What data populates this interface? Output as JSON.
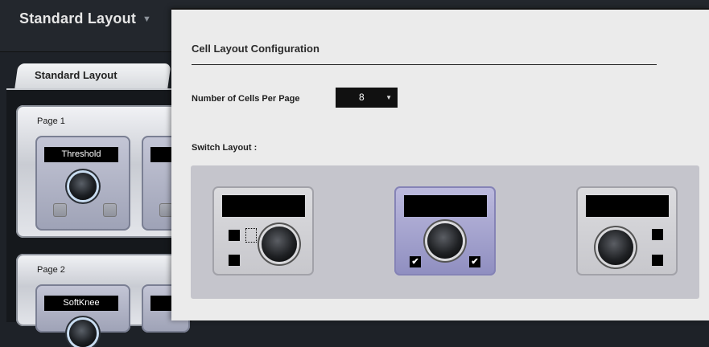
{
  "app": {
    "layout_title": "Standard Layout",
    "tab_label": "Standard Layout",
    "pages": [
      {
        "label": "Page 1",
        "cell_label": "Threshold"
      },
      {
        "label": "Page 2",
        "cell_label": "SoftKnee"
      }
    ]
  },
  "dialog": {
    "title": "Cell Layout Configuration",
    "cells_per_page_label": "Number of Cells Per Page",
    "cells_per_page_value": "8",
    "switch_layout_label": "Switch Layout :",
    "layouts": [
      {
        "id": "buttons-left",
        "selected": false
      },
      {
        "id": "buttons-below",
        "selected": true,
        "checks": [
          "✔",
          "✔"
        ]
      },
      {
        "id": "buttons-right",
        "selected": false
      }
    ]
  },
  "colors": {
    "dialog_bg": "#ebebeb",
    "selected_layout": "#a9a7d6",
    "panel_bg": "#c5c5cc"
  }
}
